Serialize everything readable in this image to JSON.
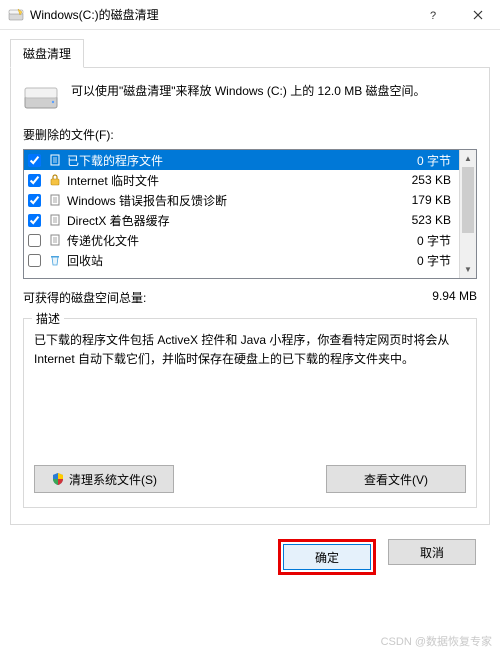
{
  "titlebar": {
    "title": "Windows(C:)的磁盘清理"
  },
  "tab": {
    "label": "磁盘清理"
  },
  "intro": "可以使用\"磁盘清理\"来释放 Windows (C:) 上的 12.0 MB 磁盘空间。",
  "files_label": "要删除的文件(F):",
  "files": [
    {
      "checked": true,
      "icon": "file-icon",
      "name": "已下载的程序文件",
      "size": "0 字节",
      "selected": true
    },
    {
      "checked": true,
      "icon": "lock-icon",
      "name": "Internet 临时文件",
      "size": "253 KB",
      "selected": false
    },
    {
      "checked": true,
      "icon": "file-icon",
      "name": "Windows 错误报告和反馈诊断",
      "size": "179 KB",
      "selected": false
    },
    {
      "checked": true,
      "icon": "file-icon",
      "name": "DirectX 着色器缓存",
      "size": "523 KB",
      "selected": false
    },
    {
      "checked": false,
      "icon": "file-icon",
      "name": "传递优化文件",
      "size": "0 字节",
      "selected": false
    },
    {
      "checked": false,
      "icon": "recycle-icon",
      "name": "回收站",
      "size": "0 字节",
      "selected": false
    }
  ],
  "total": {
    "label": "可获得的磁盘空间总量:",
    "value": "9.94 MB"
  },
  "desc": {
    "legend": "描述",
    "text": "已下载的程序文件包括 ActiveX 控件和 Java 小程序，你查看特定网页时将会从 Internet 自动下载它们，并临时保存在硬盘上的已下载的程序文件夹中。"
  },
  "buttons": {
    "clean_system": "清理系统文件(S)",
    "view_files": "查看文件(V)",
    "ok": "确定",
    "cancel": "取消"
  },
  "watermark": "CSDN @数据恢复专家"
}
